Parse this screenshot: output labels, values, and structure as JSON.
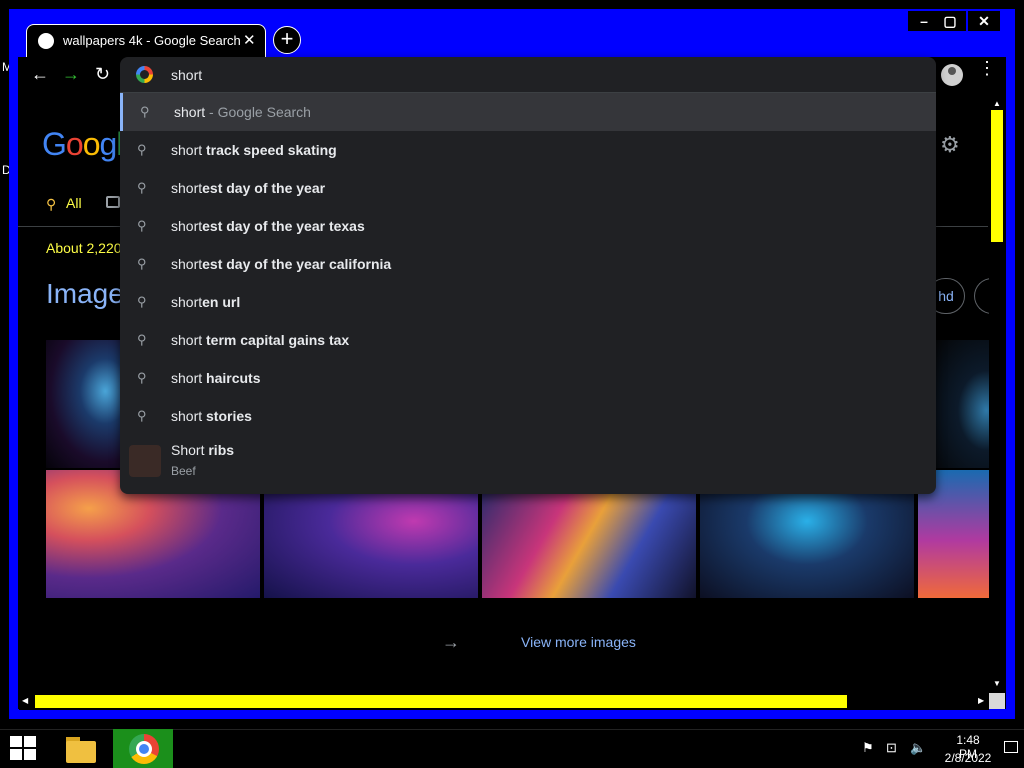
{
  "window": {
    "minimize_label": "–",
    "maximize_label": "▢",
    "close_label": "✕"
  },
  "desktop": {
    "letter_m": "M",
    "letter_d": "D"
  },
  "tab": {
    "title": "wallpapers 4k - Google Search",
    "close_label": "✕",
    "new_tab_label": "+"
  },
  "toolbar": {
    "back_label": "←",
    "forward_label": "→",
    "reload_label": "↻",
    "kebab_label": "⋮"
  },
  "omnibox": {
    "input_value": "short",
    "suggestions": [
      {
        "prefix": "short",
        "rest": "",
        "hint": " - Google Search"
      },
      {
        "prefix": "short",
        "rest": " track speed skating",
        "hint": ""
      },
      {
        "prefix": "short",
        "rest": "est day of the year",
        "hint": ""
      },
      {
        "prefix": "short",
        "rest": "est day of the year texas",
        "hint": ""
      },
      {
        "prefix": "short",
        "rest": "est day of the year california",
        "hint": ""
      },
      {
        "prefix": "short",
        "rest": "en url",
        "hint": ""
      },
      {
        "prefix": "short",
        "rest": " term capital gains tax",
        "hint": ""
      },
      {
        "prefix": "short",
        "rest": " haircuts",
        "hint": ""
      },
      {
        "prefix": "short",
        "rest": " stories",
        "hint": ""
      }
    ],
    "entity_suggestion": {
      "prefix": "Short",
      "rest": " ribs",
      "subtitle": "Beef"
    }
  },
  "page": {
    "logo_text": "Googl",
    "tab_all": "All",
    "result_stats": "About 2,220",
    "images_heading": "Image",
    "chip_hd": "hd",
    "view_more": "View more images",
    "more_arrow": "→"
  },
  "taskbar": {
    "time": "1:48 PM",
    "date": "2/8/2022"
  },
  "colors": {
    "window_frame": "#0000ff",
    "scroll_thumb": "#ffff00",
    "link": "#8ab4f8",
    "stats_text": "#fdfd46",
    "omnibox_bg": "#202124",
    "chrome_taskbar_button": "#1b8f1b"
  },
  "icons": {
    "search": "search-icon",
    "gear": "gear-icon",
    "profile": "profile-icon"
  }
}
